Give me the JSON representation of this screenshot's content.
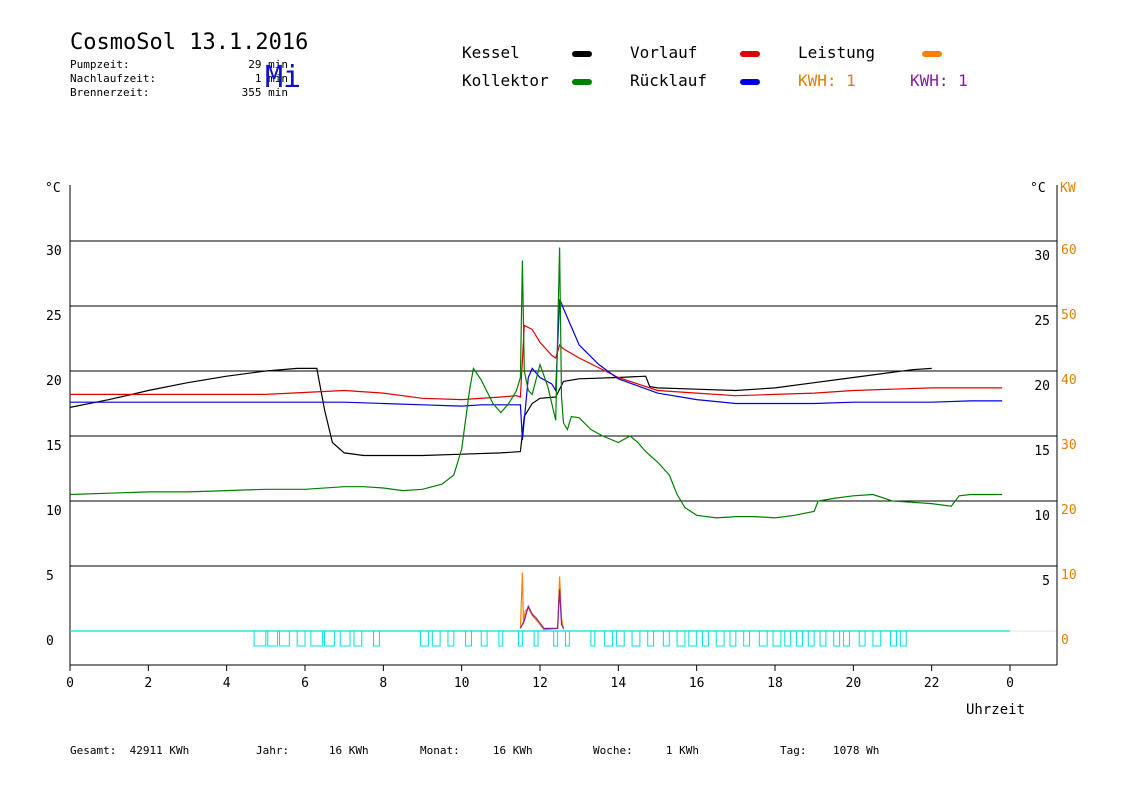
{
  "header": {
    "title": "CosmoSol 13.1.2016",
    "day": "Mi",
    "stats": [
      {
        "label": "Pumpzeit:",
        "value": "29 min"
      },
      {
        "label": "Nachlaufzeit:",
        "value": "1 min"
      },
      {
        "label": "Brennerzeit:",
        "value": "355 min"
      }
    ]
  },
  "legend": {
    "kessel": {
      "label": "Kessel",
      "color": "#000000"
    },
    "vorlauf": {
      "label": "Vorlauf",
      "color": "#e00000"
    },
    "leistung": {
      "label": "Leistung",
      "color": "#ff8000"
    },
    "kollektor": {
      "label": "Kollektor",
      "color": "#008000"
    },
    "ruecklauf": {
      "label": "Rücklauf",
      "color": "#0000e0"
    },
    "kwh1": {
      "label": "KWH: 1",
      "color": "#e08000"
    },
    "kwh2": {
      "label": "KWH: 1",
      "color": "#8020a0"
    }
  },
  "footer": {
    "gesamt_label": "Gesamt:",
    "gesamt_value": "42911 KWh",
    "jahr_label": "Jahr:",
    "jahr_value": "16 KWh",
    "monat_label": "Monat:",
    "monat_value": "16 KWh",
    "woche_label": "Woche:",
    "woche_value": "1 KWh",
    "tag_label": "Tag:",
    "tag_value": "1078 Wh"
  },
  "chart_data": {
    "type": "line",
    "xlabel": "Uhrzeit",
    "ylabel_left": "°C",
    "ylabel_right": [
      "°C",
      "KW"
    ],
    "xlim": [
      0,
      24
    ],
    "ylim": [
      -2,
      36
    ],
    "x_ticks": [
      0,
      2,
      4,
      6,
      8,
      10,
      12,
      14,
      16,
      18,
      20,
      22,
      0
    ],
    "y_ticks_left": [
      0,
      5,
      10,
      15,
      20,
      25,
      30
    ],
    "y_ticks_right_c": [
      5,
      10,
      15,
      20,
      25,
      30
    ],
    "y_ticks_right_kw": [
      0,
      10,
      20,
      30,
      40,
      50,
      60
    ],
    "gridlines_y": [
      0,
      5,
      10,
      15,
      20,
      25,
      30
    ],
    "series": [
      {
        "name": "Kessel",
        "color": "#000000",
        "x": [
          0,
          1,
          2,
          3,
          4,
          5,
          5.8,
          6.3,
          6.5,
          6.7,
          7,
          7.5,
          8,
          9,
          10,
          11,
          11.5,
          11.6,
          11.8,
          12,
          12.4,
          12.6,
          13,
          14,
          14.7,
          14.8,
          15,
          16,
          17,
          18,
          19,
          20,
          21,
          21.5,
          22
        ],
        "y": [
          17.2,
          17.8,
          18.5,
          19.1,
          19.6,
          20.0,
          20.2,
          20.2,
          17.0,
          14.5,
          13.7,
          13.5,
          13.5,
          13.5,
          13.6,
          13.7,
          13.8,
          16.5,
          17.5,
          17.9,
          18.0,
          19.2,
          19.4,
          19.5,
          19.6,
          18.8,
          18.7,
          18.6,
          18.5,
          18.7,
          19.1,
          19.5,
          19.9,
          20.1,
          20.2
        ]
      },
      {
        "name": "Vorlauf",
        "color": "#e00000",
        "x": [
          0,
          3,
          5,
          7,
          8,
          9,
          10,
          11,
          11.4,
          11.5,
          11.6,
          11.8,
          12,
          12.3,
          12.4,
          12.5,
          12.6,
          13,
          14,
          15,
          16,
          17,
          18,
          19,
          20,
          21,
          22,
          23.8
        ],
        "y": [
          18.2,
          18.2,
          18.2,
          18.5,
          18.3,
          17.9,
          17.8,
          18.0,
          18.1,
          18.0,
          23.5,
          23.2,
          22.2,
          21.2,
          21.0,
          22.0,
          21.7,
          21.0,
          19.5,
          18.5,
          18.3,
          18.1,
          18.2,
          18.3,
          18.5,
          18.6,
          18.7,
          18.7
        ]
      },
      {
        "name": "Rücklauf",
        "color": "#0000e0",
        "x": [
          0,
          4,
          7,
          8,
          9,
          10,
          10.5,
          11,
          11.4,
          11.5,
          11.55,
          11.7,
          11.8,
          12,
          12.3,
          12.4,
          12.5,
          12.55,
          12.6,
          13,
          13.5,
          14,
          15,
          16,
          17,
          18,
          19,
          20,
          21,
          22,
          23,
          23.8
        ],
        "y": [
          17.6,
          17.6,
          17.6,
          17.5,
          17.4,
          17.3,
          17.4,
          17.4,
          17.4,
          17.4,
          14.7,
          19.5,
          20.2,
          19.5,
          19.0,
          18.5,
          25.5,
          25.2,
          24.8,
          22.0,
          20.5,
          19.4,
          18.3,
          17.8,
          17.5,
          17.5,
          17.5,
          17.6,
          17.6,
          17.6,
          17.7,
          17.7
        ]
      },
      {
        "name": "Kollektor",
        "color": "#008000",
        "x": [
          0,
          1,
          2,
          3,
          4,
          5,
          6,
          7,
          7.5,
          8,
          8.5,
          9,
          9.5,
          9.8,
          10,
          10.2,
          10.3,
          10.5,
          10.8,
          11,
          11.2,
          11.4,
          11.5,
          11.55,
          11.6,
          11.7,
          11.8,
          12,
          12.2,
          12.3,
          12.4,
          12.5,
          12.55,
          12.6,
          12.7,
          12.8,
          13,
          13.3,
          13.6,
          14,
          14.3,
          14.5,
          14.7,
          15,
          15.3,
          15.5,
          15.7,
          16,
          16.5,
          17,
          17.5,
          18,
          18.5,
          19,
          19.1,
          19.5,
          20,
          20.5,
          21,
          21.5,
          22,
          22.5,
          22.7,
          23,
          23.5,
          23.8
        ],
        "y": [
          10.5,
          10.6,
          10.7,
          10.7,
          10.8,
          10.9,
          10.9,
          11.1,
          11.1,
          11.0,
          10.8,
          10.9,
          11.3,
          12.0,
          14.0,
          18.5,
          20.2,
          19.3,
          17.5,
          16.8,
          17.5,
          18.5,
          19.5,
          28.5,
          20.0,
          18.5,
          18.2,
          20.5,
          18.8,
          17.5,
          16.2,
          29.5,
          18.0,
          16.0,
          15.5,
          16.5,
          16.4,
          15.5,
          15.0,
          14.5,
          15.0,
          14.5,
          13.8,
          13.0,
          12.0,
          10.5,
          9.5,
          8.9,
          8.7,
          8.8,
          8.8,
          8.7,
          8.9,
          9.2,
          10.0,
          10.2,
          10.4,
          10.5,
          10.0,
          9.9,
          9.8,
          9.6,
          10.4,
          10.5,
          10.5,
          10.5
        ]
      },
      {
        "name": "Leistung",
        "color": "#ff8000",
        "x": [
          11.5,
          11.55,
          11.58,
          11.62,
          11.7,
          11.8,
          12.0,
          12.1,
          12.45,
          12.5,
          12.55,
          12.6
        ],
        "y": [
          0.2,
          4.5,
          0.5,
          1.5,
          1.8,
          1.2,
          0.5,
          0.1,
          0.2,
          4.2,
          1.0,
          0.1
        ]
      },
      {
        "name": "KWH",
        "color": "#8020a0",
        "x": [
          11.5,
          11.6,
          11.7,
          11.8,
          11.9,
          12.0,
          12.1,
          12.45,
          12.5,
          12.55,
          12.6
        ],
        "y": [
          0.2,
          0.8,
          1.9,
          1.3,
          1.0,
          0.6,
          0.2,
          0.2,
          3.2,
          0.5,
          0.2
        ]
      }
    ],
    "pump_baseline": {
      "color": "#00e0e0",
      "y": 0
    },
    "pump_runs": [
      [
        4.7,
        5.0
      ],
      [
        5.05,
        5.3
      ],
      [
        5.35,
        5.6
      ],
      [
        5.8,
        6.0
      ],
      [
        6.15,
        6.45
      ],
      [
        6.5,
        6.75
      ],
      [
        6.9,
        7.15
      ],
      [
        7.25,
        7.45
      ],
      [
        7.75,
        7.9
      ],
      [
        8.95,
        9.15
      ],
      [
        9.25,
        9.45
      ],
      [
        9.65,
        9.8
      ],
      [
        10.1,
        10.25
      ],
      [
        10.5,
        10.65
      ],
      [
        10.95,
        11.05
      ],
      [
        11.45,
        11.55
      ],
      [
        11.85,
        11.95
      ],
      [
        12.35,
        12.45
      ],
      [
        12.65,
        12.75
      ],
      [
        13.3,
        13.4
      ],
      [
        13.65,
        13.85
      ],
      [
        13.95,
        14.15
      ],
      [
        14.35,
        14.55
      ],
      [
        14.75,
        14.9
      ],
      [
        15.15,
        15.3
      ],
      [
        15.5,
        15.7
      ],
      [
        15.8,
        16.0
      ],
      [
        16.15,
        16.3
      ],
      [
        16.5,
        16.7
      ],
      [
        16.85,
        17.0
      ],
      [
        17.2,
        17.35
      ],
      [
        17.6,
        17.8
      ],
      [
        17.95,
        18.15
      ],
      [
        18.25,
        18.4
      ],
      [
        18.55,
        18.7
      ],
      [
        18.85,
        19.0
      ],
      [
        19.15,
        19.3
      ],
      [
        19.5,
        19.65
      ],
      [
        19.75,
        19.9
      ],
      [
        20.15,
        20.3
      ],
      [
        20.5,
        20.7
      ],
      [
        20.95,
        21.1
      ],
      [
        21.2,
        21.35
      ]
    ]
  }
}
